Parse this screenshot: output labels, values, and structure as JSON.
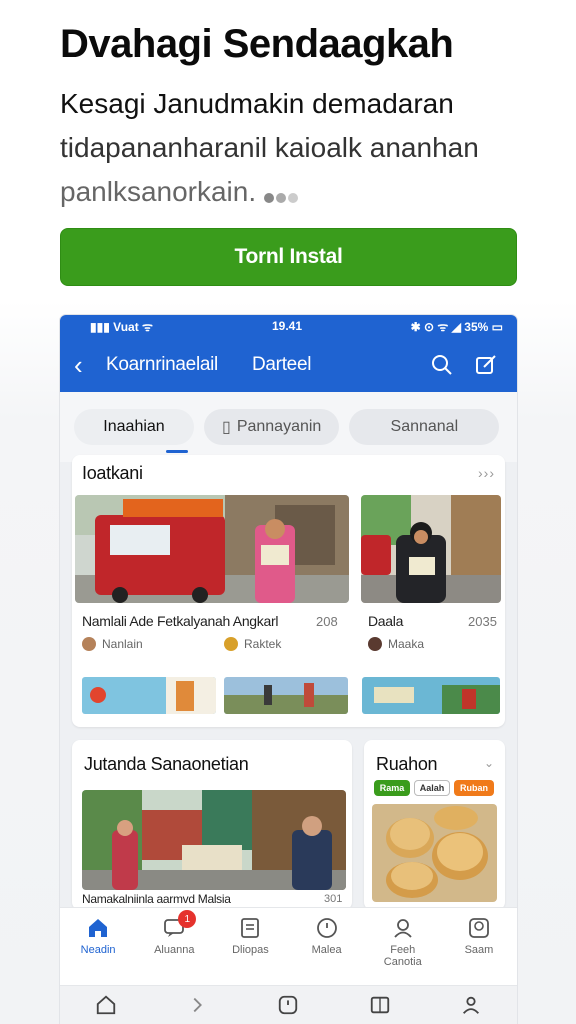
{
  "hero": {
    "title": "Dvahagi Sendaagkah",
    "desc_line1": "Kesagi Janudmakin demadaran",
    "desc_line2": "tidapananharanil kaioalk ananhan",
    "desc_line3": "panlksanorkain.",
    "install_label": "Tornl Instal"
  },
  "colors": {
    "brand_blue": "#1f63d1",
    "install_green": "#3a9c1c",
    "badge_red": "#e5322d"
  },
  "statusbar": {
    "left": "Vuat",
    "time": "19.41",
    "right": "35%"
  },
  "appbar": {
    "title": "Koarnrinaelail",
    "subtitle": "Darteel",
    "search_icon": "search-icon",
    "edit_icon": "edit-icon"
  },
  "tabs": [
    {
      "label": "Inaahian",
      "active": true
    },
    {
      "label": "Pannayanin",
      "active": false
    },
    {
      "label": "Sannanal",
      "active": false
    }
  ],
  "section1": {
    "title": "Ioatkani",
    "more": "›››",
    "items": [
      {
        "caption": "Namlali Ade Fetkalyanah Angkarl",
        "number": "208",
        "author1": "Nanlain",
        "author2": "Raktek"
      },
      {
        "caption": "Daala",
        "number": "2035",
        "author1": "Maaka"
      }
    ]
  },
  "section2": {
    "title": "Jutanda Sanaonetian",
    "caption": "Namakalniinla aarmvd Malsia",
    "number": "301"
  },
  "section3": {
    "title": "Ruahon",
    "pills": [
      {
        "label": "Rama",
        "color": "#3a9c1c"
      },
      {
        "label": "Aalah",
        "color": "#555555"
      },
      {
        "label": "Ruban",
        "color": "#f07a1a"
      }
    ]
  },
  "bottomnav": [
    {
      "label": "Neadin",
      "icon": "home-icon",
      "active": true
    },
    {
      "label": "Aluanna",
      "icon": "chat-icon",
      "active": false,
      "badge": "1"
    },
    {
      "label": "Dliopas",
      "icon": "document-icon",
      "active": false
    },
    {
      "label": "Malea",
      "icon": "clock-icon",
      "active": false
    },
    {
      "label": "Feeh Canotia",
      "icon": "people-icon",
      "active": false
    },
    {
      "label": "Saam",
      "icon": "profile-icon",
      "active": false
    }
  ]
}
